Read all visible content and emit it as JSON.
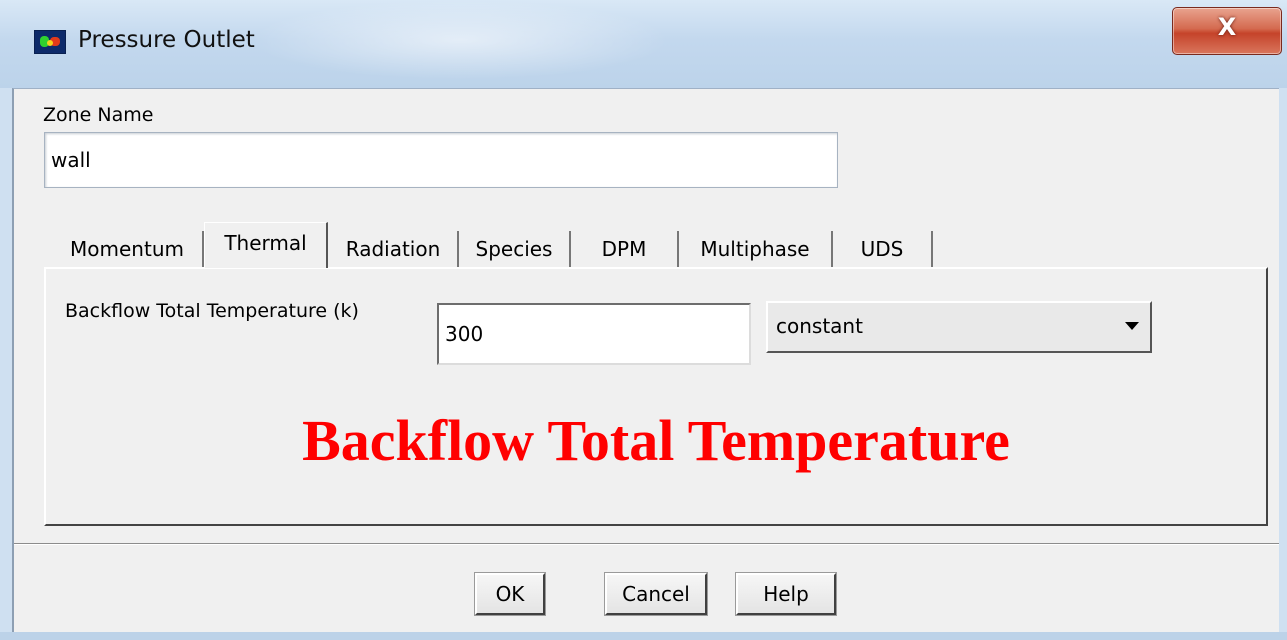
{
  "window": {
    "title": "Pressure Outlet",
    "close_label": "X"
  },
  "zone": {
    "label": "Zone Name",
    "value": "wall"
  },
  "tabs": [
    {
      "label": "Momentum",
      "active": false
    },
    {
      "label": "Thermal",
      "active": true
    },
    {
      "label": "Radiation",
      "active": false
    },
    {
      "label": "Species",
      "active": false
    },
    {
      "label": "DPM",
      "active": false
    },
    {
      "label": "Multiphase",
      "active": false
    },
    {
      "label": "UDS",
      "active": false
    }
  ],
  "thermal": {
    "backflow_label": "Backflow Total Temperature (k)",
    "backflow_value": "300",
    "method": "constant"
  },
  "annotation": {
    "text": "Backflow Total Temperature",
    "color": "#ff0000"
  },
  "buttons": {
    "ok": "OK",
    "cancel": "Cancel",
    "help": "Help"
  },
  "icons": {
    "app": "fluent-app-icon",
    "close": "close-icon",
    "dropdown": "chevron-down-icon"
  }
}
